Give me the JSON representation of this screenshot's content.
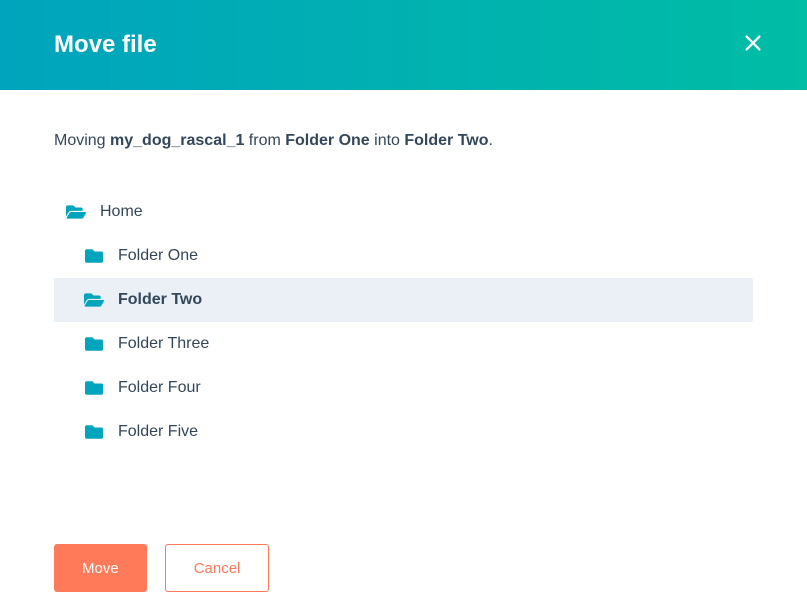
{
  "header": {
    "title": "Move file"
  },
  "moving": {
    "prefix": "Moving ",
    "filename": "my_dog_rascal_1",
    "middle1": " from ",
    "source_folder": "Folder One",
    "middle2": " into ",
    "dest_folder": "Folder Two",
    "suffix": "."
  },
  "tree": {
    "home_label": "Home",
    "folders": [
      {
        "label": "Folder One",
        "selected": false
      },
      {
        "label": "Folder Two",
        "selected": true
      },
      {
        "label": "Folder Three",
        "selected": false
      },
      {
        "label": "Folder Four",
        "selected": false
      },
      {
        "label": "Folder Five",
        "selected": false
      }
    ]
  },
  "buttons": {
    "move": "Move",
    "cancel": "Cancel"
  }
}
